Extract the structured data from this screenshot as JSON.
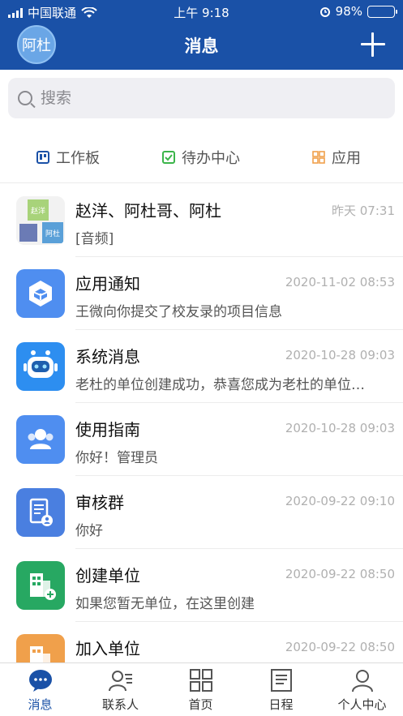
{
  "status_bar": {
    "carrier": "中国联通",
    "time": "上午 9:18",
    "battery": "98%"
  },
  "header": {
    "avatar_text": "阿杜",
    "title": "消息"
  },
  "search": {
    "placeholder": "搜索"
  },
  "quick_tabs": [
    {
      "label": "工作板",
      "icon": "board-icon",
      "color": "#1a51a7"
    },
    {
      "label": "待办中心",
      "icon": "checkbox-icon",
      "color": "#3bb54a"
    },
    {
      "label": "应用",
      "icon": "grid-icon",
      "color": "#f0a04b"
    }
  ],
  "messages": [
    {
      "name": "赵洋、阿杜哥、阿杜",
      "time": "昨天 07:31",
      "preview": "[音频]",
      "icon": "group-avatar-icon",
      "color": "#f2f2f2",
      "avatar_texts": [
        "赵洋",
        "阿杜"
      ]
    },
    {
      "name": "应用通知",
      "time": "2020-11-02 08:53",
      "preview": "王微向你提交了校友录的项目信息",
      "icon": "cube-icon",
      "color": "#4f8ef0"
    },
    {
      "name": "系统消息",
      "time": "2020-10-28 09:03",
      "preview": "老杜的单位创建成功，恭喜您成为老杜的单位…",
      "icon": "robot-icon",
      "color": "#2d8ef0"
    },
    {
      "name": "使用指南",
      "time": "2020-10-28 09:03",
      "preview": "你好！管理员",
      "icon": "people-icon",
      "color": "#4f8ef0"
    },
    {
      "name": "审核群",
      "time": "2020-09-22 09:10",
      "preview": "你好",
      "icon": "audit-document-icon",
      "color": "#4a7fe0"
    },
    {
      "name": "创建单位",
      "time": "2020-09-22 08:50",
      "preview": "如果您暂无单位，在这里创建",
      "icon": "building-add-icon",
      "color": "#27a862"
    },
    {
      "name": "加入单位",
      "time": "2020-09-22 08:50",
      "preview": "",
      "icon": "building-icon",
      "color": "#f0a04b"
    }
  ],
  "tabbar": [
    {
      "label": "消息",
      "icon": "chat-bubble-icon",
      "active": true
    },
    {
      "label": "联系人",
      "icon": "contacts-icon",
      "active": false
    },
    {
      "label": "首页",
      "icon": "home-grid-icon",
      "active": false
    },
    {
      "label": "日程",
      "icon": "schedule-icon",
      "active": false
    },
    {
      "label": "个人中心",
      "icon": "user-icon",
      "active": false
    }
  ],
  "colors": {
    "primary": "#1a51a7",
    "background": "#ffffff"
  }
}
